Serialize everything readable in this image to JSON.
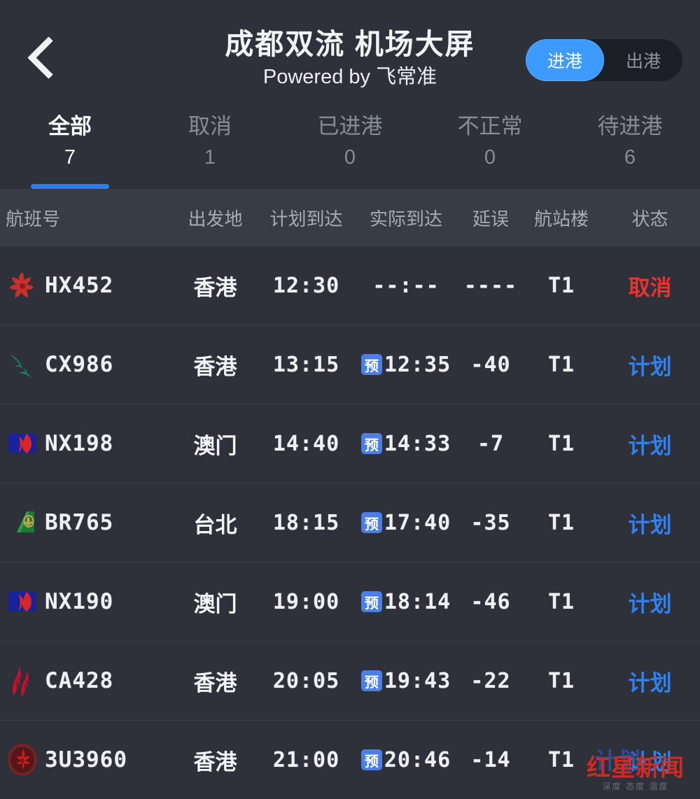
{
  "header": {
    "back_icon": "chevron-left-icon",
    "title": "成都双流 机场大屏",
    "subtitle": "Powered by 飞常准",
    "toggle": {
      "arrival_label": "进港",
      "departure_label": "出港",
      "active": "进港"
    }
  },
  "tabs": [
    {
      "label": "全部",
      "count": "7",
      "active": true
    },
    {
      "label": "取消",
      "count": "1",
      "active": false
    },
    {
      "label": "已进港",
      "count": "0",
      "active": false
    },
    {
      "label": "不正常",
      "count": "0",
      "active": false
    },
    {
      "label": "待进港",
      "count": "6",
      "active": false
    }
  ],
  "table": {
    "columns": [
      "航班号",
      "出发地",
      "计划到达",
      "实际到达",
      "延误",
      "航站楼",
      "状态"
    ],
    "estimated_badge": "预",
    "rows": [
      {
        "airline_logo": "hong-kong-airlines-logo",
        "flight_no": "HX452",
        "origin": "香港",
        "scheduled": "12:30",
        "estimated_prefix": "",
        "actual": "--:--",
        "delay": "----",
        "terminal": "T1",
        "status": "取消",
        "status_type": "cancel"
      },
      {
        "airline_logo": "cathay-pacific-logo",
        "flight_no": "CX986",
        "origin": "香港",
        "scheduled": "13:15",
        "estimated_prefix": "预",
        "actual": "12:35",
        "delay": "-40",
        "terminal": "T1",
        "status": "计划",
        "status_type": "planned"
      },
      {
        "airline_logo": "air-macau-logo",
        "flight_no": "NX198",
        "origin": "澳门",
        "scheduled": "14:40",
        "estimated_prefix": "预",
        "actual": "14:33",
        "delay": "-7",
        "terminal": "T1",
        "status": "计划",
        "status_type": "planned"
      },
      {
        "airline_logo": "eva-air-logo",
        "flight_no": "BR765",
        "origin": "台北",
        "scheduled": "18:15",
        "estimated_prefix": "预",
        "actual": "17:40",
        "delay": "-35",
        "terminal": "T1",
        "status": "计划",
        "status_type": "planned"
      },
      {
        "airline_logo": "air-macau-logo",
        "flight_no": "NX190",
        "origin": "澳门",
        "scheduled": "19:00",
        "estimated_prefix": "预",
        "actual": "18:14",
        "delay": "-46",
        "terminal": "T1",
        "status": "计划",
        "status_type": "planned"
      },
      {
        "airline_logo": "air-china-logo",
        "flight_no": "CA428",
        "origin": "香港",
        "scheduled": "20:05",
        "estimated_prefix": "预",
        "actual": "19:43",
        "delay": "-22",
        "terminal": "T1",
        "status": "计划",
        "status_type": "planned"
      },
      {
        "airline_logo": "sichuan-airlines-logo",
        "flight_no": "3U3960",
        "origin": "香港",
        "scheduled": "21:00",
        "estimated_prefix": "预",
        "actual": "20:46",
        "delay": "-14",
        "terminal": "T1",
        "status": "计划",
        "status_type": "planned"
      }
    ]
  },
  "watermark": {
    "brand_red": "红星新闻",
    "brand_blue": "计划",
    "tagline": "深度 态度 温度"
  },
  "colors": {
    "page_bg": "#2e313a",
    "header_row_bg": "#383c46",
    "accent_blue": "#2c7ef0",
    "toggle_blue": "#3d9bff",
    "status_cancel": "#e8332e",
    "status_planned": "#2f82f0",
    "badge_blue": "#4b7fe3",
    "muted_text": "#878c98"
  }
}
